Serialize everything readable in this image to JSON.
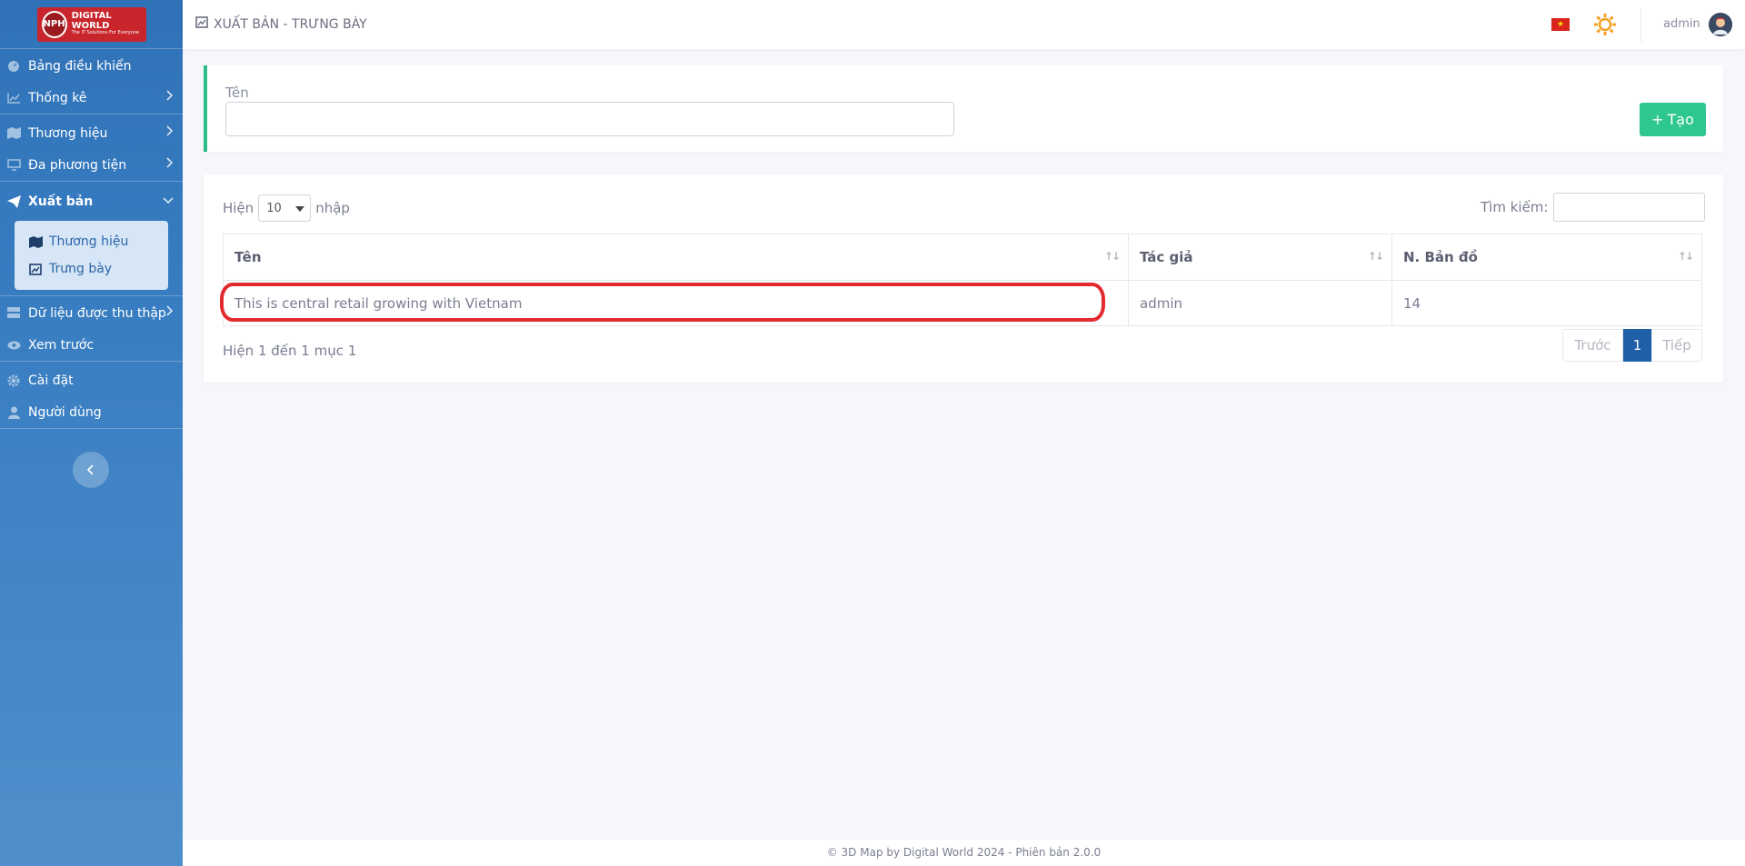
{
  "brand": {
    "badge": "NPH",
    "name": "DIGITAL WORLD",
    "tagline": "The IT Solutions For Everyone"
  },
  "sidebar": {
    "items": [
      {
        "label": "Bảng điều khiển",
        "icon": "dashboard-icon"
      },
      {
        "label": "Thống kê",
        "icon": "chart-icon"
      },
      {
        "label": "Thương hiệu",
        "icon": "map-icon"
      },
      {
        "label": "Đa phương tiện",
        "icon": "monitor-icon"
      },
      {
        "label": "Xuất bản",
        "icon": "send-icon"
      },
      {
        "label": "Dữ liệu được thu thập",
        "icon": "database-icon"
      },
      {
        "label": "Xem trước",
        "icon": "eye-icon"
      },
      {
        "label": "Cài đặt",
        "icon": "gear-icon"
      },
      {
        "label": "Người dùng",
        "icon": "user-icon"
      }
    ],
    "submenu": [
      {
        "label": "Thương hiệu",
        "icon": "map-icon"
      },
      {
        "label": "Trưng bày",
        "icon": "image-icon"
      }
    ]
  },
  "header": {
    "title": "XUẤT BẢN - TRƯNG BÀY",
    "user": "admin"
  },
  "form": {
    "name_label": "Tên",
    "name_value": "",
    "create_label": "Tạo"
  },
  "table": {
    "show_prefix": "Hiện",
    "page_size": "10",
    "show_suffix": "nhập",
    "search_label": "Tìm kiếm:",
    "columns": [
      "Tên",
      "Tác giả",
      "N. Bản đồ"
    ],
    "rows": [
      [
        "This is central retail growing with Vietnam",
        "admin",
        "14"
      ]
    ],
    "info": "Hiện 1 đến 1 mục 1",
    "pagination": {
      "prev": "Trước",
      "current": "1",
      "next": "Tiếp"
    }
  },
  "footer": {
    "text": "© 3D Map by Digital World 2024 - Phiên bản 2.0.0"
  },
  "colors": {
    "accent": "#2dc78f",
    "sidebar": "#3b80c3",
    "highlight": "#e32a2f",
    "active_page": "#1f5fa8"
  }
}
